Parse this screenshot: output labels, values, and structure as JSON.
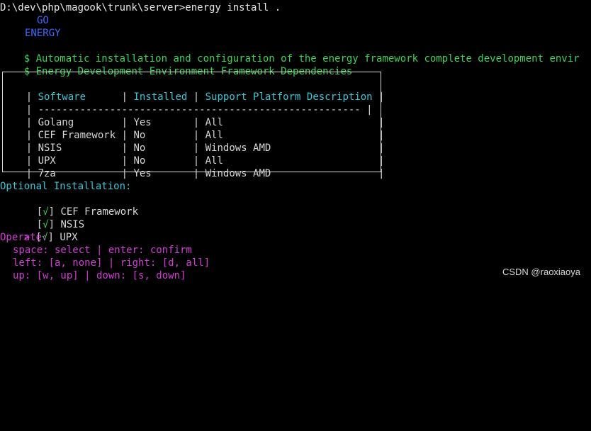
{
  "command_prompt": "D:\\dev\\php\\magook\\trunk\\server>energy install .",
  "logo": {
    "top": "GO",
    "bottom": "ENERGY"
  },
  "messages": {
    "install_description": "Automatic installation and configuration of the energy framework complete development envir",
    "dependency_title": "Energy Development Environment Framework Dependencies"
  },
  "table": {
    "headers": {
      "software": "Software",
      "installed": "Installed",
      "support_platform": "Support Platform Description"
    },
    "separator": "------------------------------------------------------",
    "rows": [
      {
        "software": "Golang",
        "installed": "Yes",
        "platform": "All"
      },
      {
        "software": "CEF Framework",
        "installed": "No",
        "platform": "All"
      },
      {
        "software": "NSIS",
        "installed": "No",
        "platform": "Windows AMD"
      },
      {
        "software": "UPX",
        "installed": "No",
        "platform": "All"
      },
      {
        "software": "7za",
        "installed": "Yes",
        "platform": "Windows AMD"
      }
    ]
  },
  "optional_installation": {
    "title": "Optional Installation:",
    "items": [
      {
        "label": "CEF Framework",
        "checked": "√",
        "selected": false
      },
      {
        "label": "NSIS",
        "checked": "√",
        "selected": false
      },
      {
        "label": "UPX",
        "checked": "√",
        "selected": true
      }
    ],
    "cursor": ">"
  },
  "operate": {
    "title": "Operate:",
    "lines": [
      "space: select | enter: confirm",
      "left: [a, none] | right: [d, all]",
      "up: [w, up] | down: [s, down]"
    ]
  },
  "watermark": "CSDN @raoxiaoya",
  "colors": {
    "background": "#000000",
    "white_text": "#e8e8e8",
    "blue_logo": "#3d68ff",
    "green_text": "#39d353",
    "cyan_text": "#38c7d7",
    "magenta_text": "#d43bd6"
  }
}
